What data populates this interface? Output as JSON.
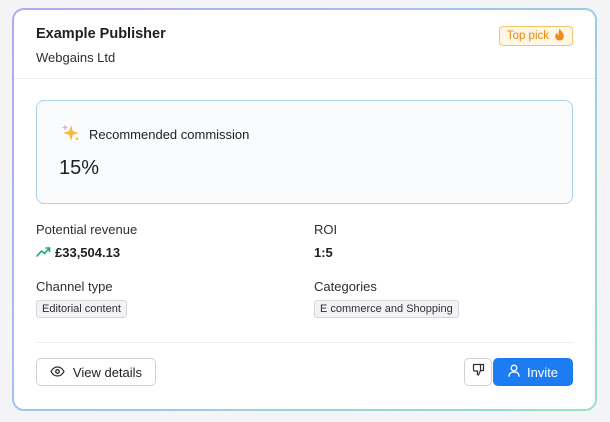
{
  "publisher": {
    "name": "Example Publisher",
    "company": "Webgains Ltd",
    "badge": "Top pick"
  },
  "commission": {
    "label": "Recommended commission",
    "value": "15%"
  },
  "metrics": {
    "potential_revenue_label": "Potential revenue",
    "potential_revenue_value": "£33,504.13",
    "roi_label": "ROI",
    "roi_value": "1:5",
    "channel_type_label": "Channel type",
    "channel_type_tag": "Editorial content",
    "categories_label": "Categories",
    "categories_tag": "E commerce and Shopping"
  },
  "actions": {
    "view_details": "View details",
    "invite": "Invite"
  },
  "colors": {
    "accent": "#1e7cf2",
    "badge_text": "#e28a12",
    "trend_green": "#19a873"
  },
  "icons": [
    "fire-icon",
    "sparkles-icon",
    "trending-up-icon",
    "eye-icon",
    "thumbs-down-icon",
    "user-icon"
  ]
}
